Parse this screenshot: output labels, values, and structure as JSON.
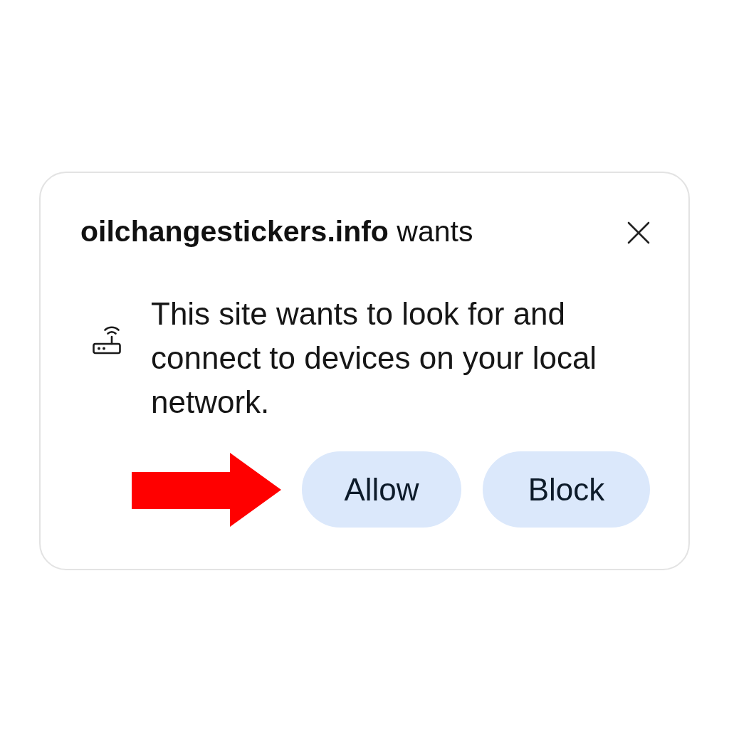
{
  "dialog": {
    "title": "**oilchangestickers.info** wants",
    "message": "This site wants to look for and connect to devices on your local network.",
    "buttons": [
      {
        "label": "Allow",
        "pointed_at": true
      },
      {
        "label": "Block",
        "pointed_at": false
      }
    ]
  }
}
